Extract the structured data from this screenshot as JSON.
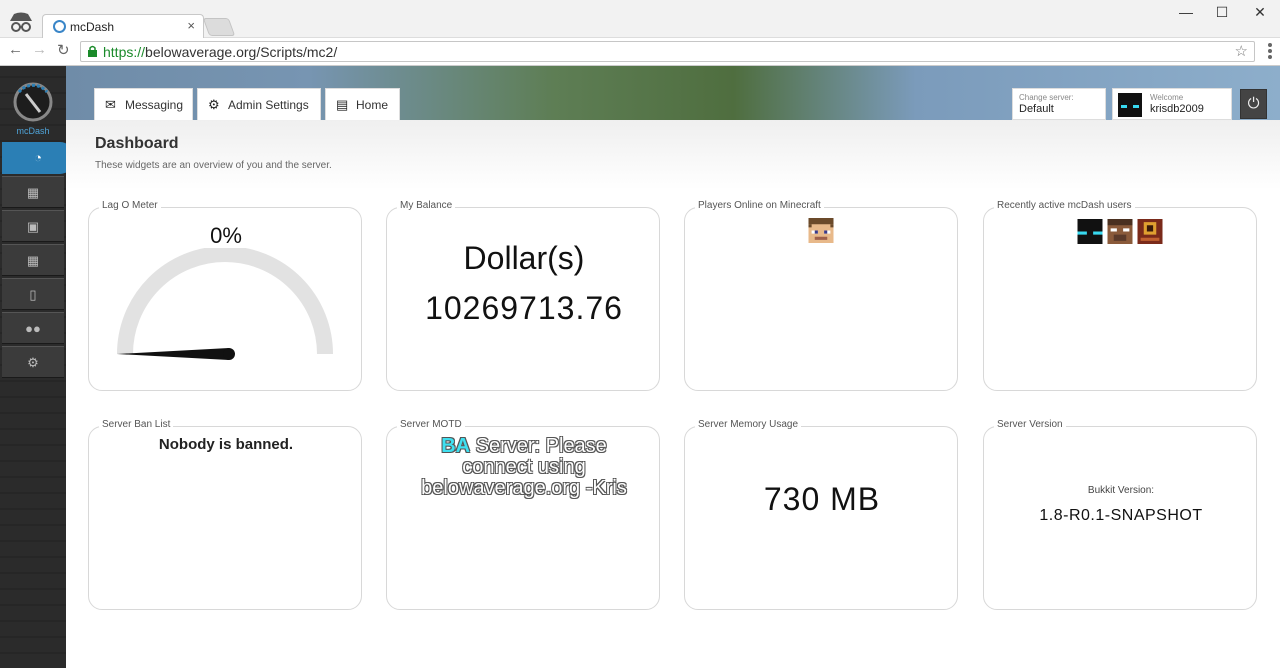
{
  "browser": {
    "tab_title": "mcDash",
    "url_https": "https://",
    "url_rest": "belowaverage.org/Scripts/mc2/",
    "minimize": "—",
    "maximize": "☐",
    "close": "✕",
    "tab_close": "×"
  },
  "nav_tabs": [
    {
      "label": "Messaging",
      "icon": "envelope-icon"
    },
    {
      "label": "Admin Settings",
      "icon": "gear-icon"
    },
    {
      "label": "Home",
      "icon": "document-icon"
    }
  ],
  "server_select": {
    "label": "Change server:",
    "value": "Default"
  },
  "welcome": {
    "label": "Welcome",
    "username": "krisdb2009"
  },
  "sidebar_items": [
    "dashboard-icon",
    "image-icon",
    "calculator-icon",
    "widgets-icon",
    "chat-icon",
    "users-icon",
    "settings-icon"
  ],
  "page": {
    "title": "Dashboard",
    "subtitle": "These widgets are an overview of you and the server."
  },
  "widgets": {
    "lag": {
      "label": "Lag O Meter",
      "value": "0%",
      "level": 0
    },
    "balance": {
      "label": "My Balance",
      "currency": "Dollar(s)",
      "amount": "10269713.76"
    },
    "players": {
      "label": "Players Online on Minecraft"
    },
    "recent": {
      "label": "Recently active mcDash users"
    },
    "banlist": {
      "label": "Server Ban List",
      "text": "Nobody is banned."
    },
    "motd": {
      "label": "Server MOTD",
      "prefix": "BA",
      "line1": " Server: Please",
      "line2": "connect using",
      "line3": "belowaverage.org -Kris"
    },
    "memory": {
      "label": "Server Memory Usage",
      "value": "730 MB"
    },
    "version": {
      "label": "Server Version",
      "caption": "Bukkit Version:",
      "value": "1.8-R0.1-SNAPSHOT"
    }
  },
  "colors": {
    "accent": "#2b7fb5",
    "secure": "#1a8a2a"
  }
}
